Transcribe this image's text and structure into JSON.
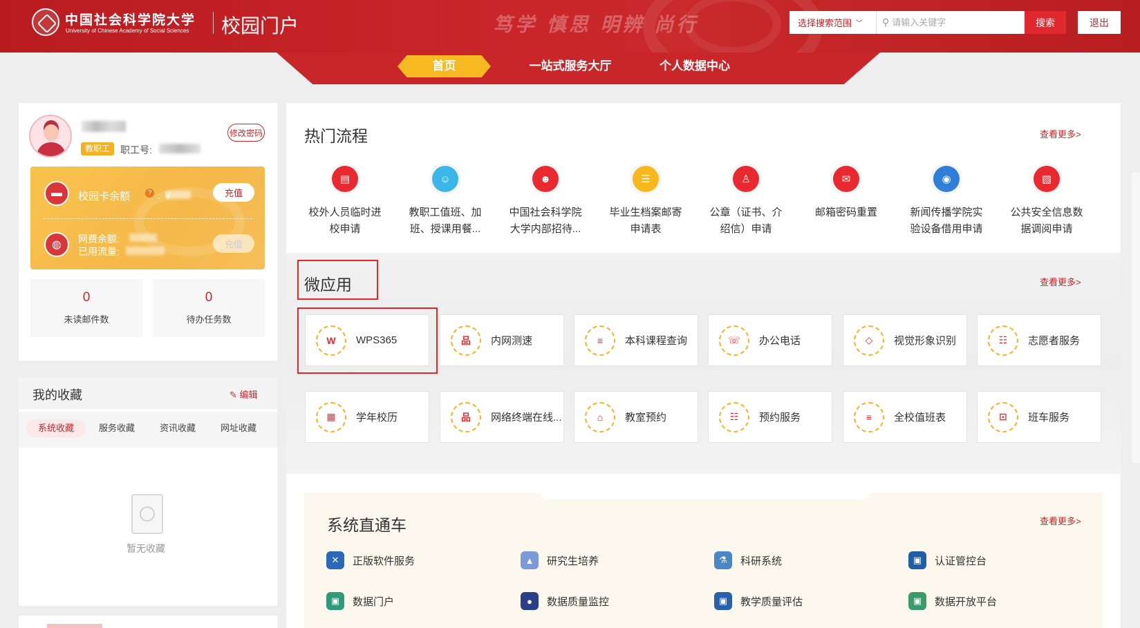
{
  "header": {
    "logo_cn": "中国社会科学院大学",
    "logo_en": "University of Chinese Academy of Social Sciences",
    "portal_title": "校园门户",
    "slogan": "笃学 慎思 明辨 尚行",
    "search_scope": "选择搜索范围",
    "search_placeholder": "请输入关键字",
    "search_button": "搜索",
    "logout_button": "退出"
  },
  "nav": {
    "home": "首页",
    "one_stop": "一站式服务大厅",
    "personal": "个人数据中心"
  },
  "profile": {
    "role_badge": "教职工",
    "staff_id_label": "职工号:",
    "change_password": "修改密码",
    "card_balance_label": "校园卡余额",
    "card_hint": "?",
    "card_currency": ": ￥",
    "card_recharge": "充值",
    "net_balance_label": "网费余额:",
    "net_flow_label": "已用流量:",
    "net_recharge": "充值",
    "unread_mail_count": "0",
    "unread_mail_label": "未读邮件数",
    "pending_task_count": "0",
    "pending_task_label": "待办任务数"
  },
  "favorites": {
    "title": "我的收藏",
    "edit": "编辑",
    "tabs": [
      "系统收藏",
      "服务收藏",
      "资讯收藏",
      "网址收藏"
    ],
    "empty_text": "暂无收藏"
  },
  "hot_processes": {
    "title": "热门流程",
    "more": "查看更多>",
    "items": [
      {
        "label1": "校外人员临时进",
        "label2": "校申请",
        "color": "#e8292f",
        "icon": "document-icon"
      },
      {
        "label1": "教职工值班、加",
        "label2": "班、授课用餐...",
        "color": "#3bb6e8",
        "icon": "badge-icon"
      },
      {
        "label1": "中国社会科学院",
        "label2": "大学内部招待...",
        "color": "#e8292f",
        "icon": "reception-icon"
      },
      {
        "label1": "毕业生档案邮寄",
        "label2": "申请表",
        "color": "#f6b81c",
        "icon": "list-icon"
      },
      {
        "label1": "公章（证书、介",
        "label2": "绍信）申请",
        "color": "#e8292f",
        "icon": "stamp-icon"
      },
      {
        "label1": "邮箱密码重置",
        "label2": "",
        "color": "#e8292f",
        "icon": "mail-icon"
      },
      {
        "label1": "新闻传播学院实",
        "label2": "验设备借用申请",
        "color": "#2f7fd8",
        "icon": "camera-icon"
      },
      {
        "label1": "公共安全信息数",
        "label2": "据调阅申请",
        "color": "#e8292f",
        "icon": "file-icon"
      }
    ]
  },
  "micro_apps": {
    "title": "微应用",
    "more": "查看更多>",
    "row1": [
      {
        "label": "WPS365",
        "glyph": "W"
      },
      {
        "label": "内网测速",
        "glyph": "品"
      },
      {
        "label": "本科课程查询",
        "glyph": "≡"
      },
      {
        "label": "办公电话",
        "glyph": "☏"
      },
      {
        "label": "视觉形象识别",
        "glyph": "◇"
      },
      {
        "label": "志愿者服务",
        "glyph": "☷"
      }
    ],
    "row2": [
      {
        "label": "学年校历",
        "glyph": "▦"
      },
      {
        "label": "网络终端在线...",
        "glyph": "品"
      },
      {
        "label": "教室预约",
        "glyph": "⌂"
      },
      {
        "label": "预约服务",
        "glyph": "☷"
      },
      {
        "label": "全校值班表",
        "glyph": "≡"
      },
      {
        "label": "班车服务",
        "glyph": "⊡"
      }
    ]
  },
  "system_shortcuts": {
    "title": "系统直通车",
    "more": "查看更多>",
    "items": [
      {
        "label": "正版软件服务",
        "color": "#2b68b8",
        "glyph": "✕"
      },
      {
        "label": "研究生培养",
        "color": "#7c9ad8",
        "glyph": "▲"
      },
      {
        "label": "科研系统",
        "color": "#4a86c8",
        "glyph": "⚗"
      },
      {
        "label": "认证管控台",
        "color": "#1f5fa8",
        "glyph": "▣"
      },
      {
        "label": "数据门户",
        "color": "#2f9a78",
        "glyph": "▣"
      },
      {
        "label": "数据质量监控",
        "color": "#2a3f88",
        "glyph": "●"
      },
      {
        "label": "教学质量评估",
        "color": "#2a5fb0",
        "glyph": "▣"
      },
      {
        "label": "数据开放平台",
        "color": "#3a9a6a",
        "glyph": "▣"
      }
    ]
  }
}
